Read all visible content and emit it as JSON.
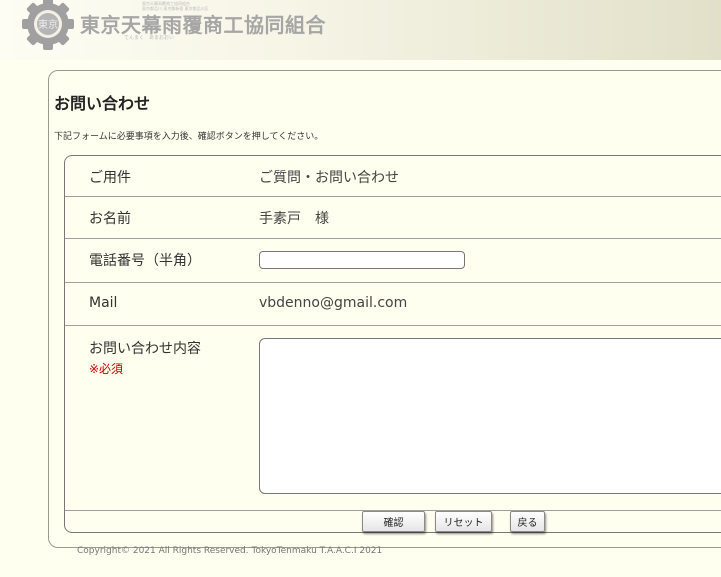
{
  "header": {
    "title": "東京天幕雨覆商工協同組合",
    "small_lines": [
      "東京天幕雨覆商工協同組合",
      "東京都品川 東京都新宿 東京都品川区"
    ],
    "ruby": "てんまく　あまおおい",
    "logo_text": "東京"
  },
  "page": {
    "title": "お問い合わせ",
    "instruction": "下記フォームに必要事項を入力後、確認ボタンを押してください。"
  },
  "form": {
    "subject": {
      "label": "ご用件",
      "value": "ご質問・お問い合わせ"
    },
    "name": {
      "label": "お名前",
      "value": "手素戸　様"
    },
    "phone": {
      "label": "電話番号（半角）",
      "value": ""
    },
    "mail": {
      "label": "Mail",
      "value": "vbdenno@gmail.com"
    },
    "inquiry": {
      "label": "お問い合わせ内容",
      "required": "※必須",
      "value": ""
    }
  },
  "buttons": {
    "confirm": "確認",
    "reset": "リセット",
    "back": "戻る"
  },
  "footer": {
    "copyright": "Copyright© 2021 All Rights Reserved. TokyoTenmaku T.A.A.C.I 2021"
  }
}
